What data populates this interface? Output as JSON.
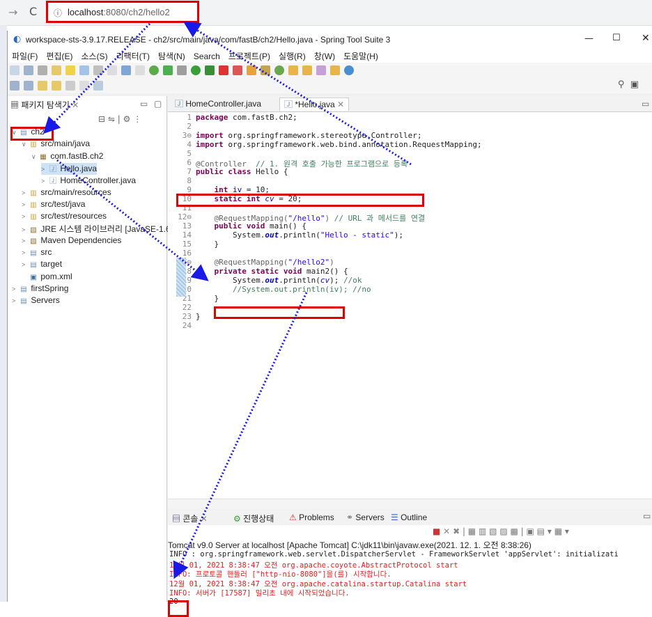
{
  "browser": {
    "forward_icon": "→",
    "reload_icon": "C",
    "info_icon": "ⓘ",
    "url_host": "localhost",
    "url_path": ":8080/ch2/hello2"
  },
  "window": {
    "title": "workspace-sts-3.9.17.RELEASE - ch2/src/main/java/com/fastB/ch2/Hello.java - Spring Tool Suite 3",
    "min": "—",
    "max": "☐",
    "close": "✕"
  },
  "menu": [
    "파일(F)",
    "편집(E)",
    "소스(S)",
    "리팩터(T)",
    "탐색(N)",
    "Search",
    "프로젝트(P)",
    "실행(R)",
    "창(W)",
    "도움말(H)"
  ],
  "package_explorer": {
    "title": "패키지 탐색기",
    "tree": [
      {
        "label": "ch2",
        "depth": 0,
        "arrow": "∨",
        "icon": "folder"
      },
      {
        "label": "src/main/java",
        "depth": 1,
        "arrow": "∨",
        "icon": "srcfolder"
      },
      {
        "label": "com.fastB.ch2",
        "depth": 2,
        "arrow": "∨",
        "icon": "package"
      },
      {
        "label": "Hello.java",
        "depth": 3,
        "arrow": ">",
        "icon": "java",
        "selected": true
      },
      {
        "label": "HomeController.java",
        "depth": 3,
        "arrow": ">",
        "icon": "java"
      },
      {
        "label": "src/main/resources",
        "depth": 1,
        "arrow": ">",
        "icon": "srcfolder"
      },
      {
        "label": "src/test/java",
        "depth": 1,
        "arrow": ">",
        "icon": "srcfolder"
      },
      {
        "label": "src/test/resources",
        "depth": 1,
        "arrow": ">",
        "icon": "srcfolder"
      },
      {
        "label": "JRE 시스템 라이브러리 [JavaSE-1.6",
        "depth": 1,
        "arrow": ">",
        "icon": "library"
      },
      {
        "label": "Maven Dependencies",
        "depth": 1,
        "arrow": ">",
        "icon": "library"
      },
      {
        "label": "src",
        "depth": 1,
        "arrow": ">",
        "icon": "folder"
      },
      {
        "label": "target",
        "depth": 1,
        "arrow": ">",
        "icon": "folder"
      },
      {
        "label": "pom.xml",
        "depth": 1,
        "arrow": "",
        "icon": "xml"
      },
      {
        "label": "firstSpring",
        "depth": 0,
        "arrow": ">",
        "icon": "folder"
      },
      {
        "label": "Servers",
        "depth": 0,
        "arrow": ">",
        "icon": "folder"
      }
    ]
  },
  "editor": {
    "tabs": [
      {
        "label": "HomeController.java",
        "active": false
      },
      {
        "label": "*Hello.java",
        "active": true
      }
    ],
    "line_numbers": [
      "1",
      "2",
      "3⊖",
      "4",
      "5",
      "6",
      "7",
      "8",
      "9",
      "10",
      "11",
      "12⊖",
      "13",
      "14",
      "15",
      "16",
      "17⊖",
      "18",
      "19",
      "20",
      "21",
      "22",
      "23",
      "24"
    ]
  },
  "console": {
    "tabs": [
      "콘솔",
      "진행상태",
      "Problems",
      "Servers",
      "Outline"
    ],
    "description": "Tomcat v9.0 Server at localhost [Apache Tomcat] C:\\jdk11\\bin\\javaw.exe(2021. 12. 1. 오전 8:38:26)",
    "lines": [
      {
        "text": "INFO : org.springframework.web.servlet.DispatcherServlet - FrameworkServlet 'appServlet': initializati",
        "kind": "info"
      },
      {
        "text": "12월 01, 2021 8:38:47 오전 org.apache.coyote.AbstractProtocol start",
        "kind": "err"
      },
      {
        "text": "INFO: 프로토콜 핸들러 [\"http-nio-8080\"]을(를) 시작합니다.",
        "kind": "err"
      },
      {
        "text": "12월 01, 2021 8:38:47 오전 org.apache.catalina.startup.Catalina start",
        "kind": "err"
      },
      {
        "text": "INFO: 서버가 [17587] 밀리초 내에 시작되었습니다.",
        "kind": "err"
      },
      {
        "text": "20",
        "kind": "info"
      }
    ]
  },
  "code": {
    "l1_kw": "package",
    "l1_rest": " com.fastB.ch2;",
    "l3_kw": "import",
    "l3_rest": " org.springframework.stereotype.Controller;",
    "l4_kw": "import",
    "l4_rest": " org.springframework.web.bind.annotation.RequestMapping;",
    "l6_ann": "@Controller",
    "l6_cm": "  // 1. 원격 호출 가능한 프로그램으로 등록",
    "l7_kw": "public class",
    "l7_rest": " Hello {",
    "l9_kw": "int",
    "l9_fld": "iv",
    "l9_rest": " = 10;",
    "l10_kw": "static int",
    "l10_fld": "cv",
    "l10_rest": " = 20;",
    "l12_ann": "@RequestMapping(",
    "l12_str": "\"/hello\"",
    "l12_close": ")",
    "l12_cm": " // URL 과 메서드를 연결",
    "l13_kw": "public void",
    "l13_rest": " main() {",
    "l14_pre": "System.",
    "l14_out": "out",
    "l14_mid": ".println(",
    "l14_str": "\"Hello - static\"",
    "l14_end": ");",
    "l15": "}",
    "l17_ann": "@RequestMapping(",
    "l17_str": "\"/hello2\"",
    "l17_close": ")",
    "l18_kw": "private static void",
    "l18_rest": " main2() {",
    "l19_pre": "System.",
    "l19_out": "out",
    "l19_mid": ".println(",
    "l19_fld": "cv",
    "l19_end": ");",
    "l19_cm": " //ok",
    "l20_cm": "//System.out.println(iv); //no",
    "l21": "}",
    "l23": "}"
  }
}
